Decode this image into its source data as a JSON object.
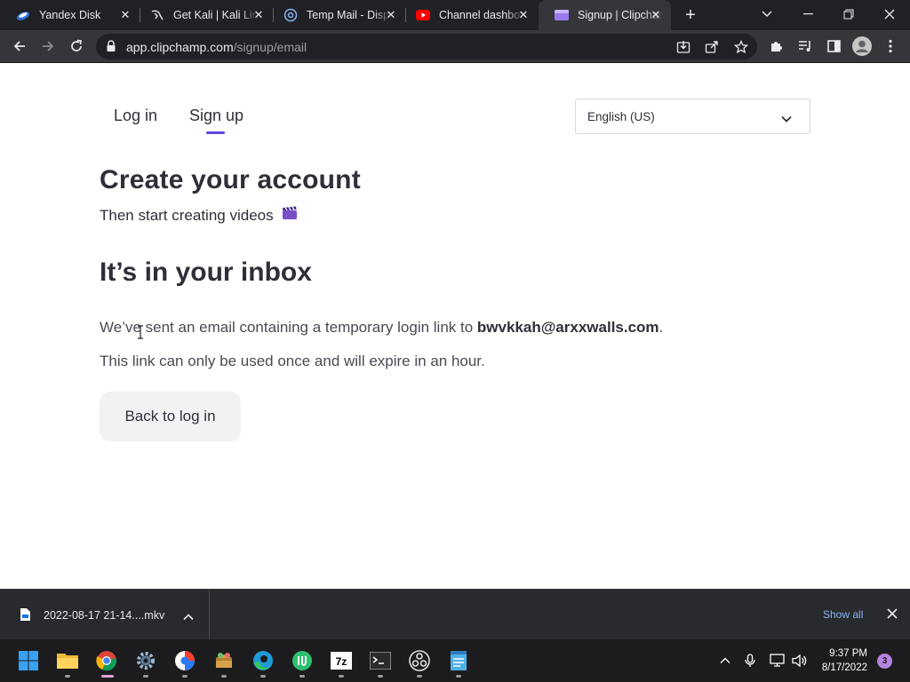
{
  "browser": {
    "tabs": [
      {
        "title": "Yandex Disk",
        "icon": "yandex-disk-icon"
      },
      {
        "title": "Get Kali | Kali Linux",
        "icon": "kali-icon"
      },
      {
        "title": "Temp Mail - Disposable",
        "icon": "at-sign-icon"
      },
      {
        "title": "Channel dashboard",
        "icon": "youtube-icon"
      },
      {
        "title": "Signup | Clipchamp",
        "icon": "clipchamp-icon",
        "active": true
      }
    ],
    "address": {
      "host": "app.clipchamp.com",
      "path": "/signup/email"
    }
  },
  "page": {
    "nav": {
      "login": "Log in",
      "signup": "Sign up",
      "active": "signup"
    },
    "language": {
      "selected": "English (US)"
    },
    "heading": "Create your account",
    "subheading": "Then start creating videos",
    "status_heading": "It’s in your inbox",
    "message_prefix": "We’ve sent an email containing a temporary login link to",
    "email": "bwvkkah@arxxwalls.com",
    "message_suffix": ".",
    "expiry_note": "This link can only be used once and will expire in an hour.",
    "back_button": "Back to log in"
  },
  "downloads": {
    "file_name": "2022-08-17 21-14....mkv",
    "show_all": "Show all"
  },
  "taskbar": {
    "time": "9:37 PM",
    "date": "8/17/2022",
    "notification_count": "3"
  },
  "colors": {
    "accent": "#5b4bdb",
    "text": "#2f2f3a",
    "button_bg": "#f2f2f5",
    "chrome_dark": "#202124",
    "link_blue": "#8ab4f8"
  }
}
